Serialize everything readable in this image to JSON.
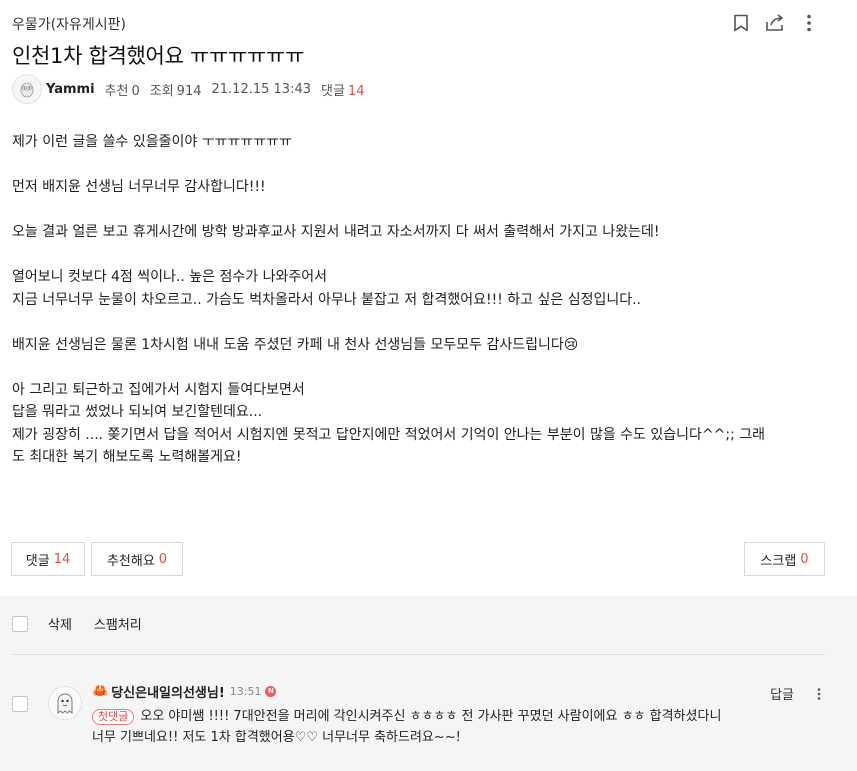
{
  "board": {
    "name": "우물가(자유게시판)"
  },
  "post": {
    "title": "인천1차 합격했어요 ㅠㅠㅠㅠㅠㅠ",
    "author": "Yammi",
    "recommend_label": "추천",
    "recommend_count": "0",
    "views_label": "조회",
    "views_count": "914",
    "datetime": "21.12.15 13:43",
    "comments_label": "댓글",
    "comments_count": "14",
    "content": [
      "제가 이런 글을 쓸수 있을줄이야 ㅜㅠㅠㅠㅠㅠㅠ",
      "",
      "먼저 배지윤 선생님 너무너무 감사합니다!!!",
      "",
      "오늘 결과 얼른 보고 휴게시간에 방학 방과후교사 지원서 내려고 자소서까지 다 써서 출력해서 가지고 나왔는데!",
      "",
      "열어보니 컷보다 4점 씩이나.. 높은 점수가 나와주어서",
      "지금 너무너무 눈물이 차오르고.. 가슴도 벅차올라서 아무나 붙잡고 저 합격했어요!!! 하고 싶은 심정입니다..",
      "",
      "배지윤 선생님은 물론 1차시험 내내 도움 주셨던 카페 내 천사 선생님들 모두모두 감사드립니다😢",
      "",
      "아 그리고 퇴근하고 집에가서 시험지 들여다보면서",
      "답을 뭐라고 썼었나 되뇌여 보긴할텐데요...",
      "제가 굉장히 .... 쫒기면서 답을 적어서 시험지엔 못적고 답안지에만 적었어서 기억이 안나는 부분이 많을 수도 있습니다^^;; 그래",
      "도 최대한 복기 해보도록 노력해볼게요!"
    ]
  },
  "actions": {
    "comments_label": "댓글",
    "comments_count": "14",
    "recommend_label": "추천해요",
    "recommend_count": "0",
    "scrap_label": "스크랩",
    "scrap_count": "0"
  },
  "admin": {
    "delete_label": "삭제",
    "spam_label": "스팸처리"
  },
  "comments": [
    {
      "emoji": "🦀",
      "author": "당신은내일의선생님!",
      "time": "13:51",
      "new_badge": "N",
      "first_badge": "첫댓글",
      "text": "오오 야미쌤 !!!! 7대안전을 머리에 각인시켜주신 ㅎㅎㅎㅎ 전 가사판 꾸몄던 사람이에요 ㅎㅎ 합격하셨다니 너무 기쁘네요!! 저도 1차 합격했어용♡♡ 너무너무 축하드려요~~!",
      "reply_label": "답글"
    }
  ],
  "colors": {
    "accent_red": "#e34c4c",
    "comment_bg": "#f5f5f5",
    "border": "#d6d6d6"
  },
  "icons": [
    "bookmark-icon",
    "share-icon",
    "more-vertical-icon",
    "owl-avatar-icon",
    "ghost-avatar-icon",
    "crab-emoji-icon"
  ]
}
